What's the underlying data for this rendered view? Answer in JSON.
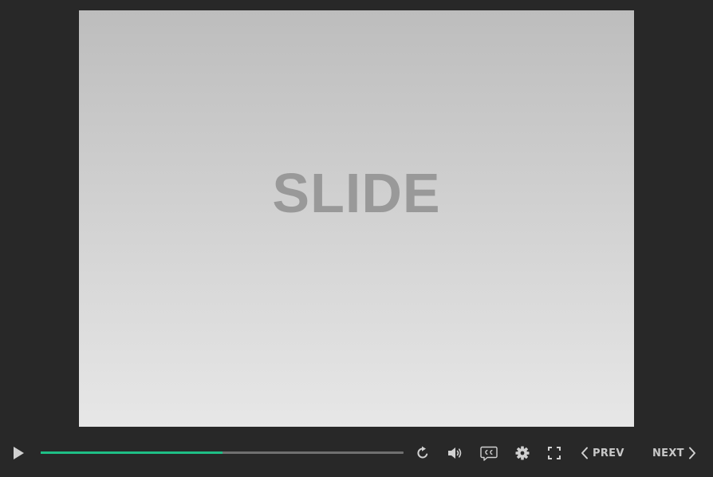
{
  "slide": {
    "title": "SLIDE"
  },
  "controls": {
    "progress": 0.5,
    "prev_label": "PREV",
    "next_label": "NEXT",
    "icons": {
      "play": "play-icon",
      "replay": "replay-icon",
      "volume": "volume-icon",
      "captions": "closed-captions-icon",
      "settings": "gear-icon",
      "fullscreen": "fullscreen-icon",
      "prev": "chevron-left-icon",
      "next": "chevron-right-icon"
    }
  },
  "colors": {
    "background": "#282828",
    "progress_fill": "#1fbf86",
    "progress_track": "#707070",
    "icon": "#d0d0d0",
    "slide_text": "#999999"
  }
}
